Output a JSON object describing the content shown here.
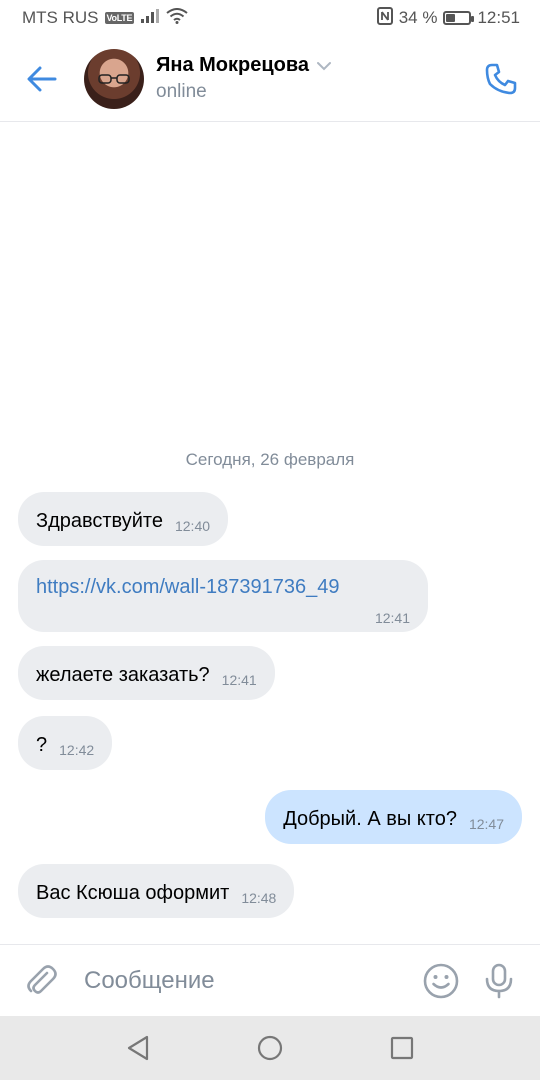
{
  "status_bar": {
    "carrier": "MTS RUS",
    "volte": "VoLTE",
    "battery_percent_text": "34 %",
    "battery_level": 0.34,
    "time": "12:51"
  },
  "header": {
    "contact_name": "Яна Мокрецова",
    "contact_status": "online"
  },
  "chat": {
    "date_separator": "Сегодня, 26 февраля",
    "messages": [
      {
        "direction": "in",
        "text": "Здравствуйте",
        "time": "12:40"
      },
      {
        "direction": "in",
        "text": "https://vk.com/wall-187391736_49",
        "time": "12:41",
        "is_link": true
      },
      {
        "direction": "in",
        "text": "желаете заказать?",
        "time": "12:41"
      },
      {
        "direction": "in",
        "text": "?",
        "time": "12:42"
      },
      {
        "direction": "out",
        "text": "Добрый. А вы кто?",
        "time": "12:47"
      },
      {
        "direction": "in",
        "text": "Вас Ксюша оформит",
        "time": "12:48"
      }
    ]
  },
  "composer": {
    "placeholder": "Сообщение"
  },
  "colors": {
    "accent": "#3f8ae0",
    "incoming_bubble": "#ebedf0",
    "outgoing_bubble": "#cce4ff",
    "secondary_text": "#818c99"
  },
  "icons": {
    "back": "arrow-left-icon",
    "dropdown": "chevron-down-icon",
    "call": "phone-icon",
    "attach": "paperclip-icon",
    "emoji": "smile-icon",
    "mic": "microphone-icon",
    "nav_back": "triangle-back-icon",
    "nav_home": "circle-home-icon",
    "nav_recents": "square-recents-icon"
  }
}
